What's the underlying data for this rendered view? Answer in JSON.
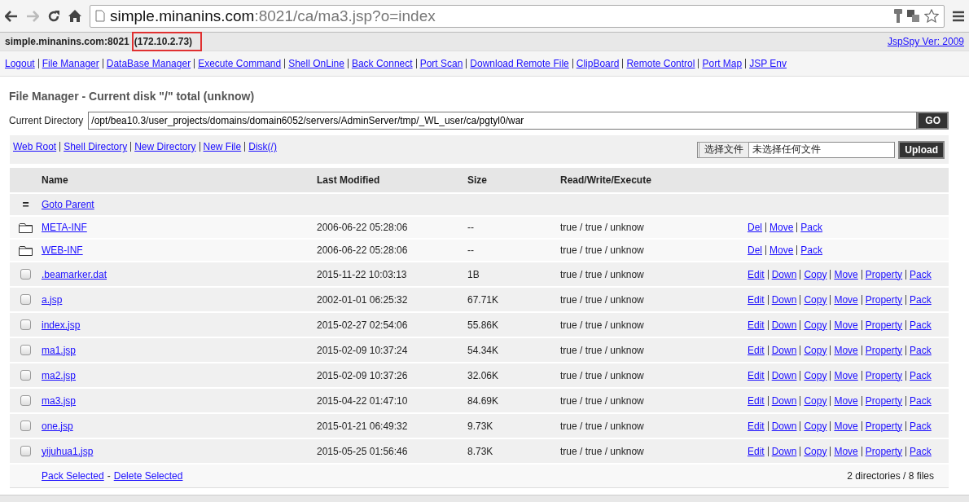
{
  "browser": {
    "url_host": "simple.minanins.com",
    "url_rest": ":8021/ca/ma3.jsp?o=index"
  },
  "header": {
    "host": "simple.minanins.com:8021",
    "ip": "(172.10.2.73)",
    "version": "JspSpy Ver: 2009"
  },
  "nav": [
    "Logout",
    "File Manager",
    "DataBase Manager",
    "Execute Command",
    "Shell OnLine",
    "Back Connect",
    "Port Scan",
    "Download Remote File",
    "ClipBoard",
    "Remote Control",
    "Port Map",
    "JSP Env"
  ],
  "title": "File Manager - Current disk \"/\" total (unknow)",
  "current_directory": {
    "label": "Current Directory",
    "value": "/opt/bea10.3/user_projects/domains/domain6052/servers/AdminServer/tmp/_WL_user/ca/pgtyl0/war",
    "button": "GO"
  },
  "tool_links": [
    "Web Root",
    "Shell Directory",
    "New Directory",
    "New File",
    "Disk(/)"
  ],
  "upload": {
    "choose_button": "选择文件",
    "status": "未选择任何文件",
    "button": "Upload"
  },
  "table": {
    "columns": [
      "Name",
      "Last Modified",
      "Size",
      "Read/Write/Execute"
    ],
    "parent": {
      "icon": "=",
      "link": "Goto Parent"
    },
    "rows": [
      {
        "kind": "folder",
        "name": "META-INF",
        "modified": "2006-06-22 05:28:06",
        "size": "--",
        "rwx": "true / true / unknow",
        "actions": [
          "Del",
          "Move",
          "Pack"
        ]
      },
      {
        "kind": "folder",
        "name": "WEB-INF",
        "modified": "2006-06-22 05:28:06",
        "size": "--",
        "rwx": "true / true / unknow",
        "actions": [
          "Del",
          "Move",
          "Pack"
        ]
      },
      {
        "kind": "file",
        "checked": false,
        "name": ".beamarker.dat",
        "modified": "2015-11-22 10:03:13",
        "size": "1B",
        "rwx": "true / true / unknow",
        "actions": [
          "Edit",
          "Down",
          "Copy",
          "Move",
          "Property",
          "Pack"
        ]
      },
      {
        "kind": "file",
        "checked": false,
        "name": "a.jsp",
        "modified": "2002-01-01 06:25:32",
        "size": "67.71K",
        "rwx": "true / true / unknow",
        "actions": [
          "Edit",
          "Down",
          "Copy",
          "Move",
          "Property",
          "Pack"
        ]
      },
      {
        "kind": "file",
        "checked": false,
        "name": "index.jsp",
        "modified": "2015-02-27 02:54:06",
        "size": "55.86K",
        "rwx": "true / true / unknow",
        "actions": [
          "Edit",
          "Down",
          "Copy",
          "Move",
          "Property",
          "Pack"
        ]
      },
      {
        "kind": "file",
        "checked": false,
        "name": "ma1.jsp",
        "modified": "2015-02-09 10:37:24",
        "size": "54.34K",
        "rwx": "true / true / unknow",
        "actions": [
          "Edit",
          "Down",
          "Copy",
          "Move",
          "Property",
          "Pack"
        ]
      },
      {
        "kind": "file",
        "checked": false,
        "name": "ma2.jsp",
        "modified": "2015-02-09 10:37:26",
        "size": "32.06K",
        "rwx": "true / true / unknow",
        "actions": [
          "Edit",
          "Down",
          "Copy",
          "Move",
          "Property",
          "Pack"
        ]
      },
      {
        "kind": "file",
        "checked": false,
        "name": "ma3.jsp",
        "modified": "2015-04-22 01:47:10",
        "size": "84.69K",
        "rwx": "true / true / unknow",
        "actions": [
          "Edit",
          "Down",
          "Copy",
          "Move",
          "Property",
          "Pack"
        ]
      },
      {
        "kind": "file",
        "checked": false,
        "name": "one.jsp",
        "modified": "2015-01-21 06:49:32",
        "size": "9.73K",
        "rwx": "true / true / unknow",
        "actions": [
          "Edit",
          "Down",
          "Copy",
          "Move",
          "Property",
          "Pack"
        ]
      },
      {
        "kind": "file",
        "checked": false,
        "name": "yijuhua1.jsp",
        "modified": "2015-05-25 01:56:46",
        "size": "8.73K",
        "rwx": "true / true / unknow",
        "actions": [
          "Edit",
          "Down",
          "Copy",
          "Move",
          "Property",
          "Pack"
        ]
      }
    ],
    "footer": {
      "actions": [
        "Pack Selected",
        "Delete Selected"
      ],
      "joiner": "-",
      "summary": "2 directories / 8 files"
    }
  }
}
